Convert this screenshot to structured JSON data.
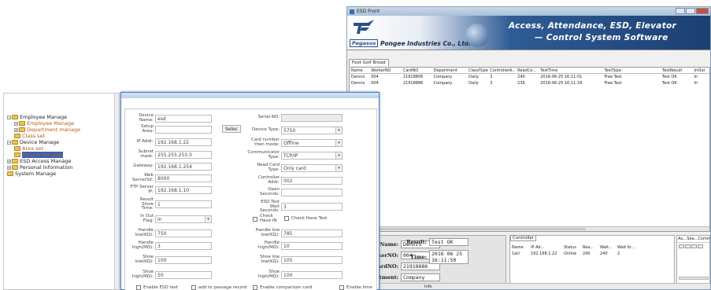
{
  "back_window": {
    "title": "ESD Front",
    "brand": "Pegasus",
    "company": "Pongee Industries Co., Ltd.",
    "slogan_line1": "Access, Attendance, ESD, Elevator",
    "slogan_line2": "— Control System Software",
    "grid_tab": "Foot Golf Broad",
    "grid_columns": [
      "Name",
      "WorkerNO",
      "CardNO",
      "Department",
      "ClassType",
      "ControllerA...",
      "ReadCo...",
      "TestTime",
      "TestType",
      "TestResult",
      "InOut"
    ],
    "grid_rows": [
      [
        "Dennis",
        "004",
        "21918806",
        "Company",
        "Daily",
        "3",
        "240",
        "2016-06-25 16:11:01",
        "Free Test",
        "Test OK",
        "In"
      ],
      [
        "Dennis",
        "004",
        "21918886",
        "Company",
        "Daily",
        "3",
        "239",
        "2016-06-25 16:11:18",
        "Free Test",
        "Test OK",
        "In"
      ]
    ],
    "info": {
      "name_label": "Name:",
      "name": "Dennis",
      "worker_label": "WorkerNO:",
      "worker": "004",
      "card_label": "CardNO:",
      "card": "21918886",
      "dept_label": "Department:",
      "dept": "Company",
      "result_label": "Result:",
      "result": "Test OK",
      "time_label": "Time:",
      "time_date": "2016 06 25",
      "time_clock": "16:11:50"
    },
    "controller": {
      "tab": "Controller",
      "columns": [
        "Name",
        "IP Ad...",
        "Status",
        "Rea...",
        "Wait...",
        "Wait fo..."
      ],
      "row": [
        "1aU",
        "192.168.1.22",
        "Online",
        "240",
        "240",
        "2"
      ]
    },
    "right_panel_title": "Au...Sea...Comm...",
    "status_text": "Info"
  },
  "tree": {
    "items": [
      {
        "label": "Employee Manage",
        "level": 0,
        "expander": "−"
      },
      {
        "label": "Employee Manage",
        "level": 1,
        "expander": "+"
      },
      {
        "label": "Department manage",
        "level": 1,
        "expander": "+"
      },
      {
        "label": "Class set",
        "level": 1,
        "expander": ""
      },
      {
        "label": "Device Manage",
        "level": 0,
        "expander": "−"
      },
      {
        "label": "Area set",
        "level": 1,
        "expander": ""
      },
      {
        "label": "Device Manage",
        "level": 1,
        "expander": "",
        "selected": true
      },
      {
        "label": "ESD Access Manage",
        "level": 0,
        "expander": "+"
      },
      {
        "label": "Personal Information",
        "level": 0,
        "expander": "+"
      },
      {
        "label": "System Manage",
        "level": 0,
        "expander": ""
      }
    ]
  },
  "dialog": {
    "device_name_label": "Device\nName:",
    "device_name": "esd",
    "setup_area_label": "Setup\nArea:",
    "setup_area": "",
    "select_button": "Selec",
    "ip_label": "IP Addr:",
    "ip": "192.168.1.22",
    "subnet_label": "Subnet\nmask:",
    "subnet": "255.255.255.0",
    "gateway_label": "Gateway:",
    "gateway": "192.168.1.254",
    "web_port_label": "Web\nServerSit:",
    "web_port": "8000",
    "ftp_server_label": "FTP Server\nIP:",
    "ftp_server": "192.168.1.10",
    "result_show_label": "Result\nShow\nTime:",
    "result_show": "1",
    "inout_flag_label": "In Out\nFlag:",
    "inout_flag": "In",
    "handle_low_label": "Handle\nlow(KΩ):",
    "handle_low": "750",
    "handle_high_label": "Handle\nhigh(MΩ):",
    "handle_high": "3",
    "shoe_low_label": "Shoe\nlow(KΩ):",
    "shoe_low": "100",
    "shoe_high_label": "Shoe\nhigh(MΩ):",
    "shoe_high": "50",
    "serial_label": "Serial NO:",
    "serial": "",
    "device_type_label": "Device Type:",
    "device_type": "5750",
    "card_mode_label": "Card number\nthen mode:",
    "card_mode": "Offline",
    "comm_type_label": "Communicator\nType:",
    "comm_type": "TCP/IP",
    "read_card_label": "Read Card\nType:",
    "read_card": "Only card",
    "controller_addr_label": "Controller\nAddr:",
    "controller_addr": "002",
    "open_seconds_label": "Open\nSeconds:",
    "open_seconds": "",
    "esd_test_wait_label": "ESD Test\nWait\nSeconds:",
    "esd_test_wait": "3",
    "check_in_label": "Check\nHave IN",
    "check_have_test_label": "Check Have Test",
    "handle_low2_label": "Handle low\nlow(KΩ):",
    "handle_low2": "785",
    "handle_high2_label": "Handle\nhigh(MΩ):",
    "handle_high2": "10",
    "shoe_low2_label": "Shoe low\nlow(KΩ):",
    "shoe_low2": "105",
    "shoe_high2_label": "Shoe\nhigh(MΩ):",
    "shoe_high2": "100",
    "bottom_checks": [
      "Enable ESD test",
      "add to passage record",
      "Enable comparison card",
      "Enable time"
    ]
  }
}
